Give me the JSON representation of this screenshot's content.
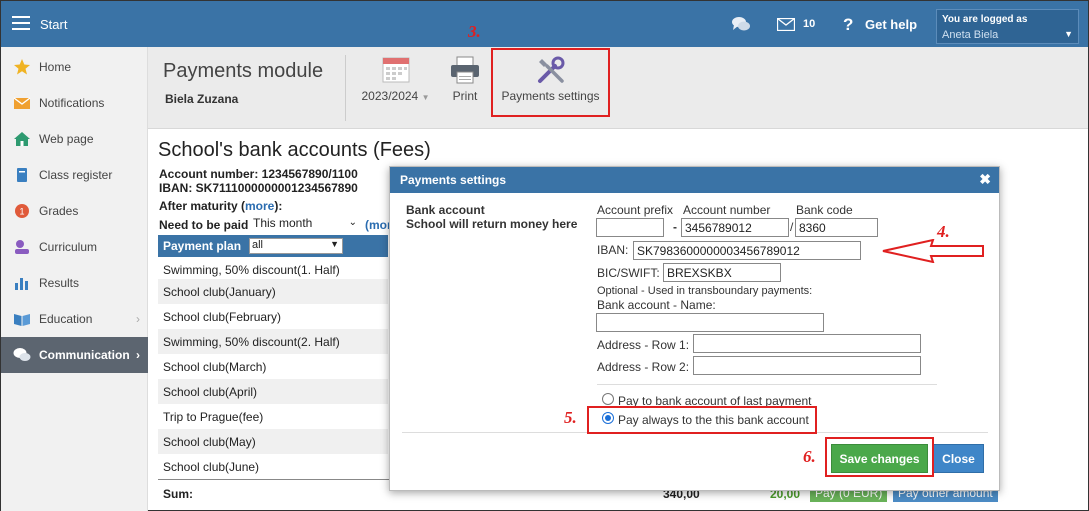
{
  "topbar": {
    "start_label": "Start",
    "mail_count": "10",
    "help_label": "Get help",
    "user_logged_label": "You are logged as",
    "user_name": "Aneta Biela"
  },
  "sidebar": {
    "items": [
      {
        "label": "Home",
        "icon": "star-icon"
      },
      {
        "label": "Notifications",
        "icon": "envelope-icon"
      },
      {
        "label": "Web page",
        "icon": "house-icon"
      },
      {
        "label": "Class register",
        "icon": "book-icon"
      },
      {
        "label": "Grades",
        "icon": "grades-icon"
      },
      {
        "label": "Curriculum",
        "icon": "curriculum-icon"
      },
      {
        "label": "Results",
        "icon": "bar-chart-icon"
      },
      {
        "label": "Education",
        "icon": "open-book-icon"
      },
      {
        "label": "Communication",
        "icon": "speech-bubbles-icon"
      }
    ]
  },
  "module": {
    "title": "Payments module",
    "subtitle": "Biela Zuzana",
    "year_label": "2023/2024",
    "print_label": "Print",
    "settings_label": "Payments settings"
  },
  "steps": {
    "s3": "3.",
    "s4": "4.",
    "s5": "5.",
    "s6": "6."
  },
  "main": {
    "title": "School's bank accounts (Fees)",
    "account_line": "Account number: 1234567890/1100",
    "iban_line": "IBAN: SK7111000000001234567890",
    "after_maturity": "After maturity (",
    "after_more": "more",
    "after_end": "):",
    "need_paid_label": "Need to be paid",
    "need_paid_value": "This month",
    "need_more": "(mor",
    "plan_label": "Payment plan",
    "plan_value": "all",
    "plan_rows": [
      "Swimming, 50% discount(1. Half)",
      "School club(January)",
      "School club(February)",
      "Swimming, 50% discount(2. Half)",
      "School club(March)",
      "School club(April)",
      "Trip to Prague(fee)",
      "School club(May)",
      "School club(June)"
    ],
    "sum_label": "Sum:",
    "sum_value1": "340,00",
    "sum_value2": "20,00",
    "pay_button": "Pay (0 EUR)",
    "pay_other_button": "Pay other amount"
  },
  "dialog": {
    "title": "Payments settings",
    "close_glyph": "✖",
    "bank_account_label": "Bank account",
    "return_money_label": "School will return money here",
    "prefix_label": "Account prefix",
    "account_number_label": "Account number",
    "bank_code_label": "Bank code",
    "prefix_value": "",
    "account_number_value": "3456789012",
    "bank_code_value": "8360",
    "dash": "-",
    "slash": "/",
    "iban_label": "IBAN:",
    "iban_value": "SK7983600000003456789012",
    "bic_label": "BIC/SWIFT:",
    "bic_value": "BREXSKBX",
    "optional_note": "Optional - Used in transboundary payments:",
    "bank_name_label": "Bank account - Name:",
    "bank_name_value": "",
    "addr1_label": "Address - Row 1:",
    "addr1_value": "",
    "addr2_label": "Address - Row 2:",
    "addr2_value": "",
    "radio1_label": "Pay to bank account of last payment",
    "radio2_label": "Pay always to the this bank account",
    "selected_radio": 2,
    "save_label": "Save changes",
    "close_label": "Close"
  },
  "colors": {
    "header_blue": "#3a73a6",
    "annotation_red": "#e02020",
    "save_green": "#4aa84a",
    "close_blue": "#3f86c8"
  }
}
